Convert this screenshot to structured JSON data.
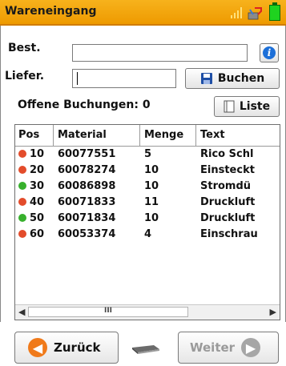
{
  "titlebar": {
    "title": "Wareneingang"
  },
  "form": {
    "best_label": "Best.",
    "best_value": "",
    "liefer_label": "Liefer.",
    "liefer_value": "",
    "buchen_label": "Buchen",
    "offene_label": "Offene Buchungen: 0",
    "liste_label": "Liste"
  },
  "table": {
    "headers": [
      "Pos",
      "Material",
      "Menge",
      "Text"
    ],
    "rows": [
      {
        "status": "red",
        "pos": "10",
        "material": "60077551",
        "menge": "5",
        "text": "Rico Schl"
      },
      {
        "status": "red",
        "pos": "20",
        "material": "60078274",
        "menge": "10",
        "text": "Einsteckt"
      },
      {
        "status": "green",
        "pos": "30",
        "material": "60086898",
        "menge": "10",
        "text": "Stromdü"
      },
      {
        "status": "red",
        "pos": "40",
        "material": "60071833",
        "menge": "11",
        "text": "Druckluft"
      },
      {
        "status": "green",
        "pos": "50",
        "material": "60071834",
        "menge": "10",
        "text": "Druckluft"
      },
      {
        "status": "red",
        "pos": "60",
        "material": "60053374",
        "menge": "4",
        "text": "Einschrau"
      }
    ],
    "scroll_grip": "III"
  },
  "nav": {
    "back_label": "Zurück",
    "next_label": "Weiter"
  },
  "colors": {
    "accent": "#f0a200",
    "red": "#e34c2b",
    "green": "#37b02c",
    "back_arrow": "#f07a1a",
    "next_arrow": "#9d9d9d"
  },
  "icons": {
    "signal": "signal-icon",
    "connection": "connection-icon",
    "battery": "battery-icon",
    "info": "info-icon",
    "save": "save-icon",
    "list": "list-icon",
    "scanner": "scanner-icon",
    "back": "arrow-left-icon",
    "next": "arrow-right-icon"
  }
}
